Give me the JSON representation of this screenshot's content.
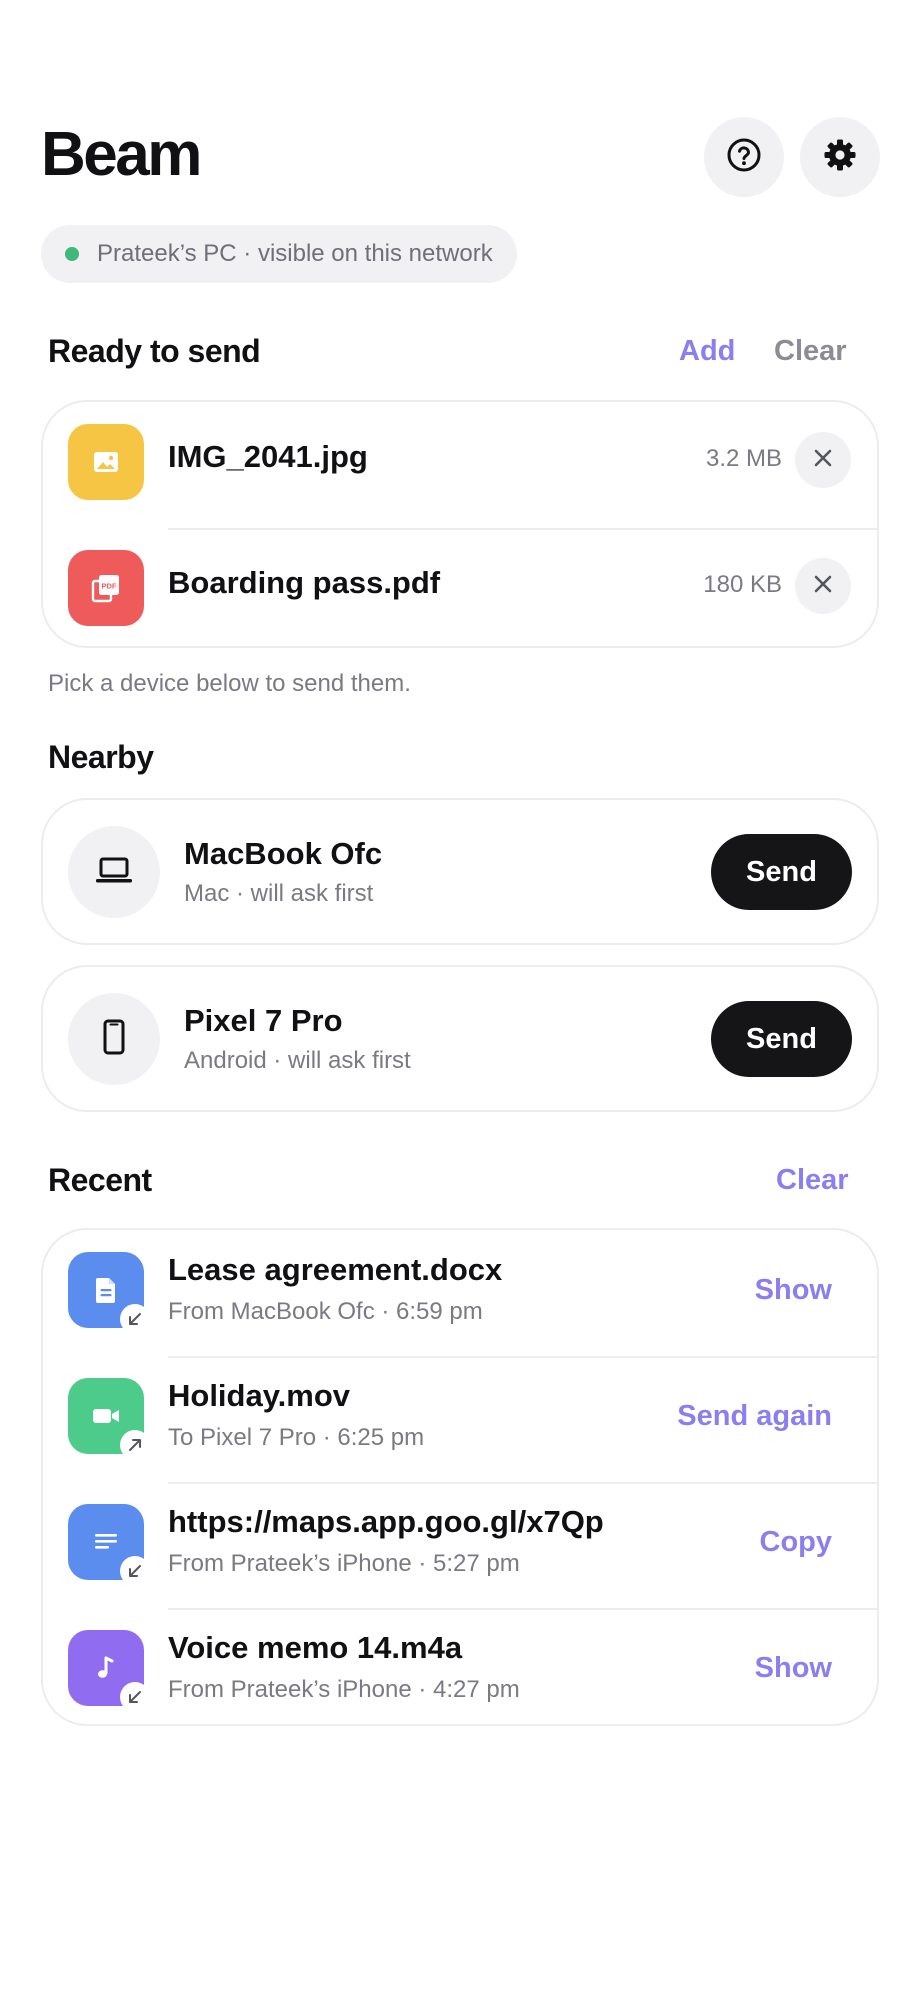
{
  "app": {
    "title": "Beam",
    "help_icon": "help-circle-icon",
    "settings_icon": "gear-icon"
  },
  "status": {
    "text": "Prateek’s PC · visible on this network",
    "dot_color": "#3fb97a"
  },
  "ready": {
    "title": "Ready to send",
    "add_label": "Add",
    "clear_label": "Clear",
    "files": [
      {
        "name": "IMG_2041.jpg",
        "size": "3.2 MB",
        "icon": "image-icon",
        "color": "#f6c544"
      },
      {
        "name": "Boarding pass.pdf",
        "size": "180 KB",
        "icon": "pdf-icon",
        "color": "#ef5a5a"
      }
    ],
    "hint": "Pick a device below to send them."
  },
  "nearby": {
    "title": "Nearby",
    "devices": [
      {
        "name": "MacBook Ofc",
        "sub": "Mac · will ask first",
        "icon": "laptop-icon",
        "action": "Send"
      },
      {
        "name": "Pixel 7 Pro",
        "sub": "Android · will ask first",
        "icon": "phone-icon",
        "action": "Send"
      }
    ]
  },
  "recent": {
    "title": "Recent",
    "clear_label": "Clear",
    "items": [
      {
        "name": "Lease agreement.docx",
        "sub": "From MacBook Ofc · 6:59 pm",
        "action": "Show",
        "icon": "document-icon",
        "color": "#5b8def",
        "direction": "received"
      },
      {
        "name": "Holiday.mov",
        "sub": "To Pixel 7 Pro · 6:25 pm",
        "action": "Send again",
        "icon": "video-icon",
        "color": "#4ccb8a",
        "direction": "sent"
      },
      {
        "name": "https://maps.app.goo.gl/x7Qp",
        "sub": "From Prateek’s iPhone · 5:27 pm",
        "action": "Copy",
        "icon": "text-lines-icon",
        "color": "#5b8def",
        "direction": "received"
      },
      {
        "name": "Voice memo 14.m4a",
        "sub": "From Prateek’s iPhone · 4:27 pm",
        "action": "Show",
        "icon": "music-note-icon",
        "color": "#8f6cf0",
        "direction": "received"
      }
    ]
  },
  "colors": {
    "accent": "#8b7ff0",
    "primary_button": "#151518"
  }
}
